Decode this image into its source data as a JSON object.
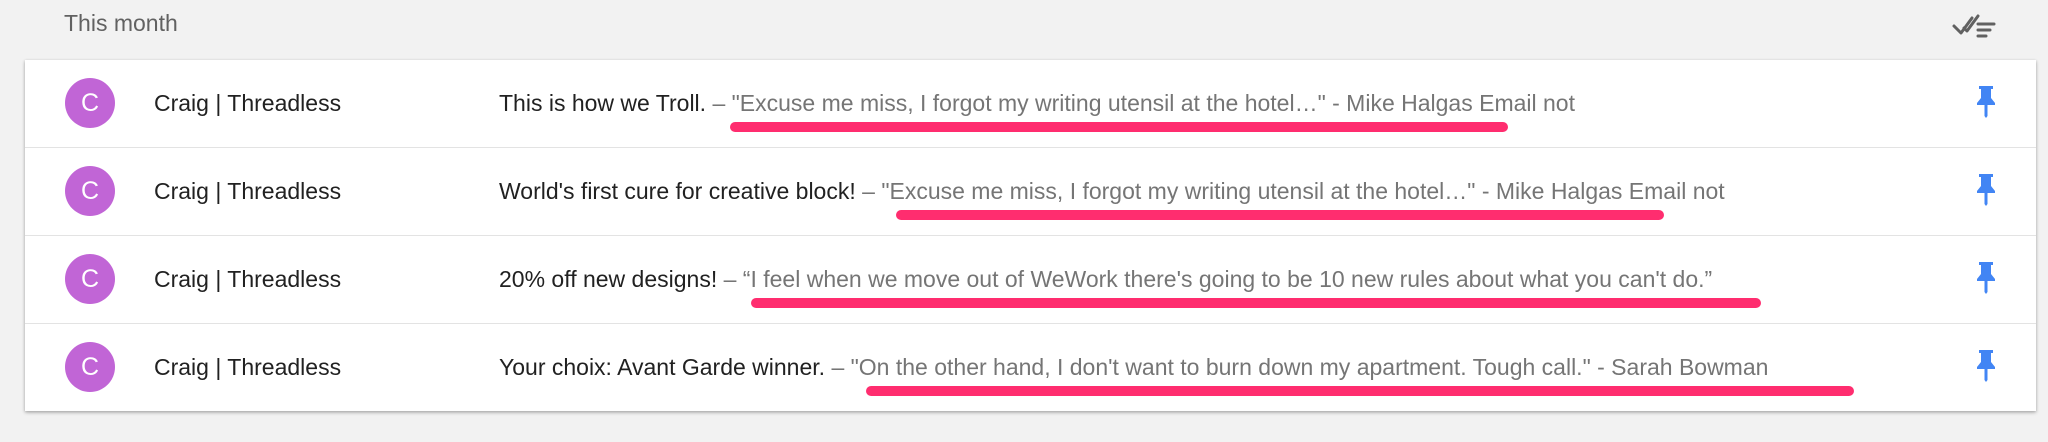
{
  "section": {
    "title": "This month"
  },
  "icons": {
    "sweep": "done-all-sweep-icon",
    "pin": "pin-icon"
  },
  "colors": {
    "avatar": "#c165d6",
    "annotation_underline": "#ff2d6f",
    "pin": "#4285f4"
  },
  "emails": [
    {
      "avatar_letter": "C",
      "sender": "Craig | Threadless",
      "subject": "This is how we Troll. ",
      "snippet": " – \"Excuse me miss, I forgot my writing utensil at the hotel…\" - Mike Halgas Email not"
    },
    {
      "avatar_letter": "C",
      "sender": "Craig | Threadless",
      "subject": "World's first cure for creative block!",
      "snippet": " – \"Excuse me miss, I forgot my writing utensil at the hotel…\" - Mike Halgas Email not"
    },
    {
      "avatar_letter": "C",
      "sender": "Craig | Threadless",
      "subject": "20% off new designs!",
      "snippet": " – “I feel when we move out of WeWork there's going to be 10 new rules about what you can't do.”"
    },
    {
      "avatar_letter": "C",
      "sender": "Craig | Threadless",
      "subject": "Your choix: Avant Garde winner. ",
      "snippet": " – \"On the other hand, I don't want to burn down my apartment. Tough call.\" - Sarah Bowman"
    }
  ]
}
